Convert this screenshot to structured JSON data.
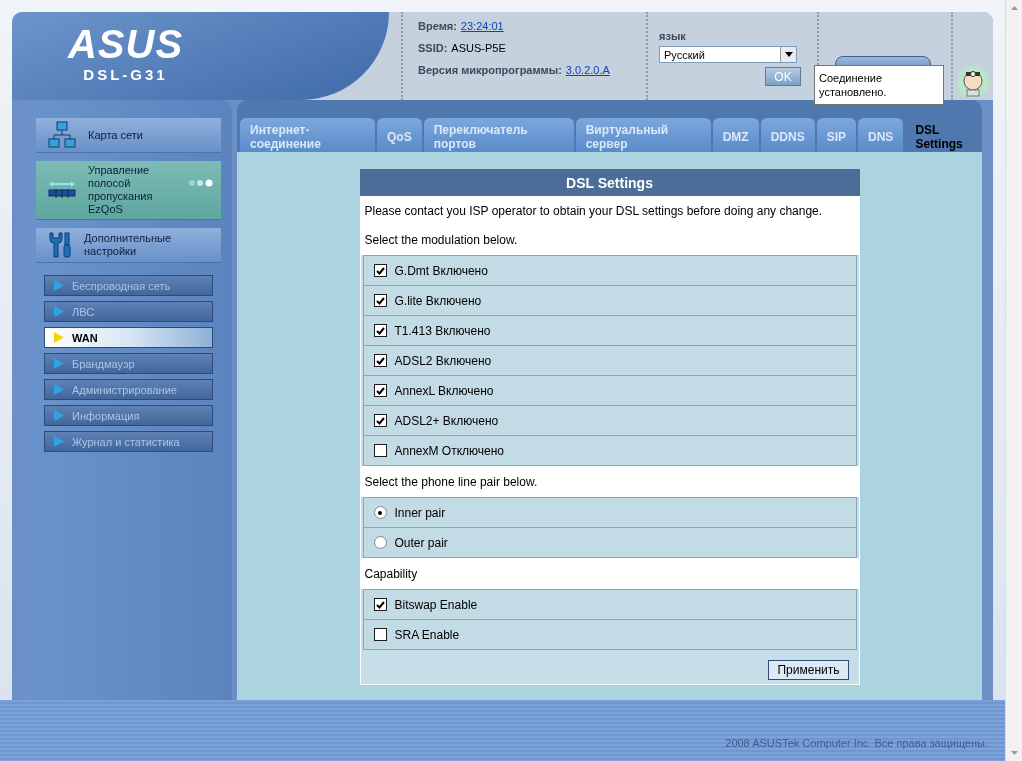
{
  "header": {
    "logo": "ASUS",
    "model": "DSL-G31",
    "time_label": "Время:",
    "time": "23:24:01",
    "ssid_label": "SSID:",
    "ssid": "ASUS-P5E",
    "firmware_label": "Версия микропрограммы:",
    "firmware": "3.0.2.0.A",
    "language_label": "язык",
    "language": "Русский",
    "ok_button": "OK",
    "status_tooltip": "Соединение установлено."
  },
  "sidebar": {
    "main_items": [
      {
        "kind": "map",
        "label": "Карта сети",
        "selected": false
      },
      {
        "kind": "qos",
        "label": "Управление полосой пропускания EzQoS",
        "selected": true
      },
      {
        "kind": "tools",
        "label": "Дополнительные настройки",
        "selected": false
      }
    ],
    "items": [
      {
        "label": "Беспроводная сеть",
        "selected": false
      },
      {
        "label": "ЛВС",
        "selected": false
      },
      {
        "label": "WAN",
        "selected": true
      },
      {
        "label": "Брандмауэр",
        "selected": false
      },
      {
        "label": "Администрирование",
        "selected": false
      },
      {
        "label": "Информация",
        "selected": false
      },
      {
        "label": "Журнал и статистика",
        "selected": false
      }
    ]
  },
  "tabs": [
    {
      "label": "Интернет-соединение",
      "selected": false
    },
    {
      "label": "QoS",
      "selected": false
    },
    {
      "label": "Переключатель портов",
      "selected": false
    },
    {
      "label": "Виртуальный сервер",
      "selected": false
    },
    {
      "label": "DMZ",
      "selected": false
    },
    {
      "label": "DDNS",
      "selected": false
    },
    {
      "label": "SIP",
      "selected": false
    },
    {
      "label": "DNS",
      "selected": false
    },
    {
      "label": "DSL Settings",
      "selected": true
    }
  ],
  "panel": {
    "title": "DSL Settings",
    "notice": "Please contact you ISP operator to obtain your DSL settings before doing any change.",
    "modulation_label": "Select the modulation below.",
    "modulations": [
      {
        "label": "G.Dmt Включено",
        "checked": true
      },
      {
        "label": "G.lite Включено",
        "checked": true
      },
      {
        "label": "T1.413 Включено",
        "checked": true
      },
      {
        "label": "ADSL2 Включено",
        "checked": true
      },
      {
        "label": "AnnexL Включено",
        "checked": true
      },
      {
        "label": "ADSL2+ Включено",
        "checked": true
      },
      {
        "label": "AnnexM Отключено",
        "checked": false
      }
    ],
    "pair_label": "Select the phone line pair below.",
    "pairs": [
      {
        "label": "Inner pair",
        "selected": true
      },
      {
        "label": "Outer pair",
        "selected": false
      }
    ],
    "capability_label": "Capability",
    "capabilities": [
      {
        "label": "Bitswap Enable",
        "checked": true
      },
      {
        "label": "SRA Enable",
        "checked": false
      }
    ],
    "apply_button": "Применить"
  },
  "footer": "2008 ASUSTek Computer Inc. Все права защищены."
}
